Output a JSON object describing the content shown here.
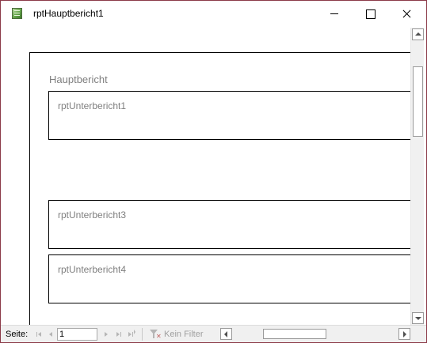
{
  "window": {
    "title": "rptHauptbericht1",
    "icon": "access-report-icon"
  },
  "report": {
    "title": "Hauptbericht",
    "subreports": [
      {
        "label": "rptUnterbericht1"
      },
      {
        "label": "rptUnterbericht3"
      },
      {
        "label": "rptUnterbericht4"
      }
    ]
  },
  "navigation": {
    "page_label": "Seite:",
    "page_value": "1",
    "filter_label": "Kein Filter"
  },
  "colors": {
    "window_border": "#8b3a48",
    "label_gray": "#7f7f7f",
    "statusbar_bg": "#f0f0f0"
  }
}
